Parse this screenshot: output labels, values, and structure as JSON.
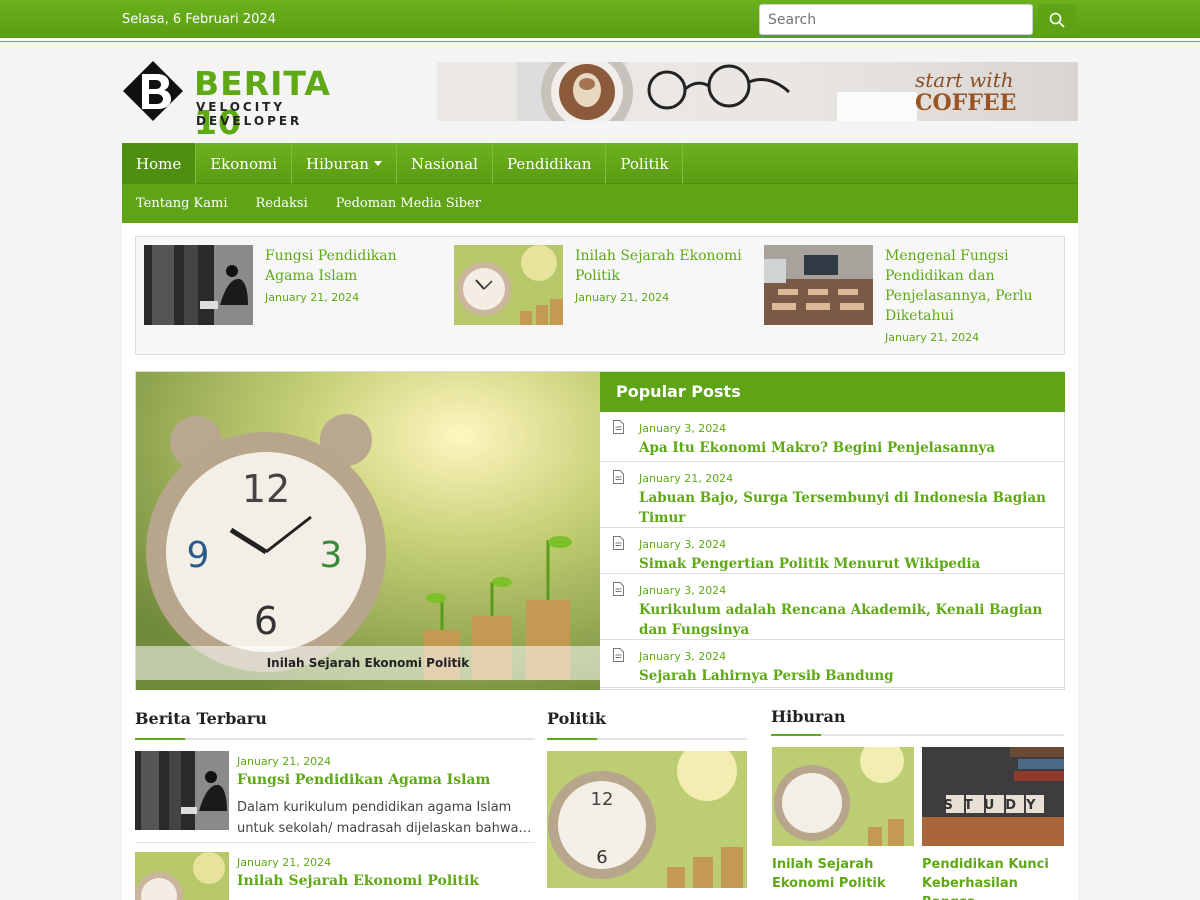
{
  "topbar": {
    "date": "Selasa, 6 Februari 2024",
    "search_placeholder": "Search"
  },
  "brand": {
    "title": "BERITA 10",
    "subtitle": "VELOCITY DEVELOPER"
  },
  "banner": {
    "line1": "start with",
    "line2": "COFFEE"
  },
  "nav": {
    "main": [
      "Home",
      "Ekonomi",
      "Hiburan",
      "Nasional",
      "Pendidikan",
      "Politik"
    ],
    "sub": [
      "Tentang Kami",
      "Redaksi",
      "Pedoman Media Siber"
    ]
  },
  "highlights": [
    {
      "title": "Fungsi Pendidikan Agama Islam",
      "date": "January 21, 2024"
    },
    {
      "title": "Inilah Sejarah Ekonomi Politik",
      "date": "January 21, 2024"
    },
    {
      "title": "Mengenal Fungsi Pendidikan dan Penjelasannya, Perlu Diketahui",
      "date": "January 21, 2024"
    }
  ],
  "featured": {
    "caption": "Inilah Sejarah Ekonomi Politik"
  },
  "popular": {
    "heading": "Popular Posts",
    "items": [
      {
        "date": "January 3, 2024",
        "title": "Apa Itu Ekonomi Makro? Begini Penjelasannya"
      },
      {
        "date": "January 21, 2024",
        "title": "Labuan Bajo, Surga Tersembunyi di Indonesia Bagian Timur"
      },
      {
        "date": "January 3, 2024",
        "title": "Simak Pengertian Politik Menurut Wikipedia"
      },
      {
        "date": "January 3, 2024",
        "title": "Kurikulum adalah Rencana Akademik, Kenali Bagian dan Fungsinya"
      },
      {
        "date": "January 3, 2024",
        "title": "Sejarah Lahirnya Persib Bandung"
      }
    ]
  },
  "sections": {
    "terbaru": {
      "heading": "Berita Terbaru",
      "items": [
        {
          "date": "January 21, 2024",
          "title": "Fungsi Pendidikan Agama Islam",
          "excerpt": "Dalam kurikulum pendidikan agama Islam untuk sekolah/ madrasah dijelaskan bahwa…"
        },
        {
          "date": "January 21, 2024",
          "title": "Inilah Sejarah Ekonomi Politik",
          "excerpt": ""
        }
      ]
    },
    "politik": {
      "heading": "Politik"
    },
    "hiburan": {
      "heading": "Hiburan",
      "items": [
        {
          "title": "Inilah Sejarah Ekonomi Politik"
        },
        {
          "title": "Pendidikan Kunci Keberhasilan Bangsa"
        }
      ],
      "study_text": "STUDY"
    }
  },
  "colors": {
    "brand_green": "#5ea915",
    "nav_green": "#5fa416",
    "text_dark": "#222222"
  }
}
